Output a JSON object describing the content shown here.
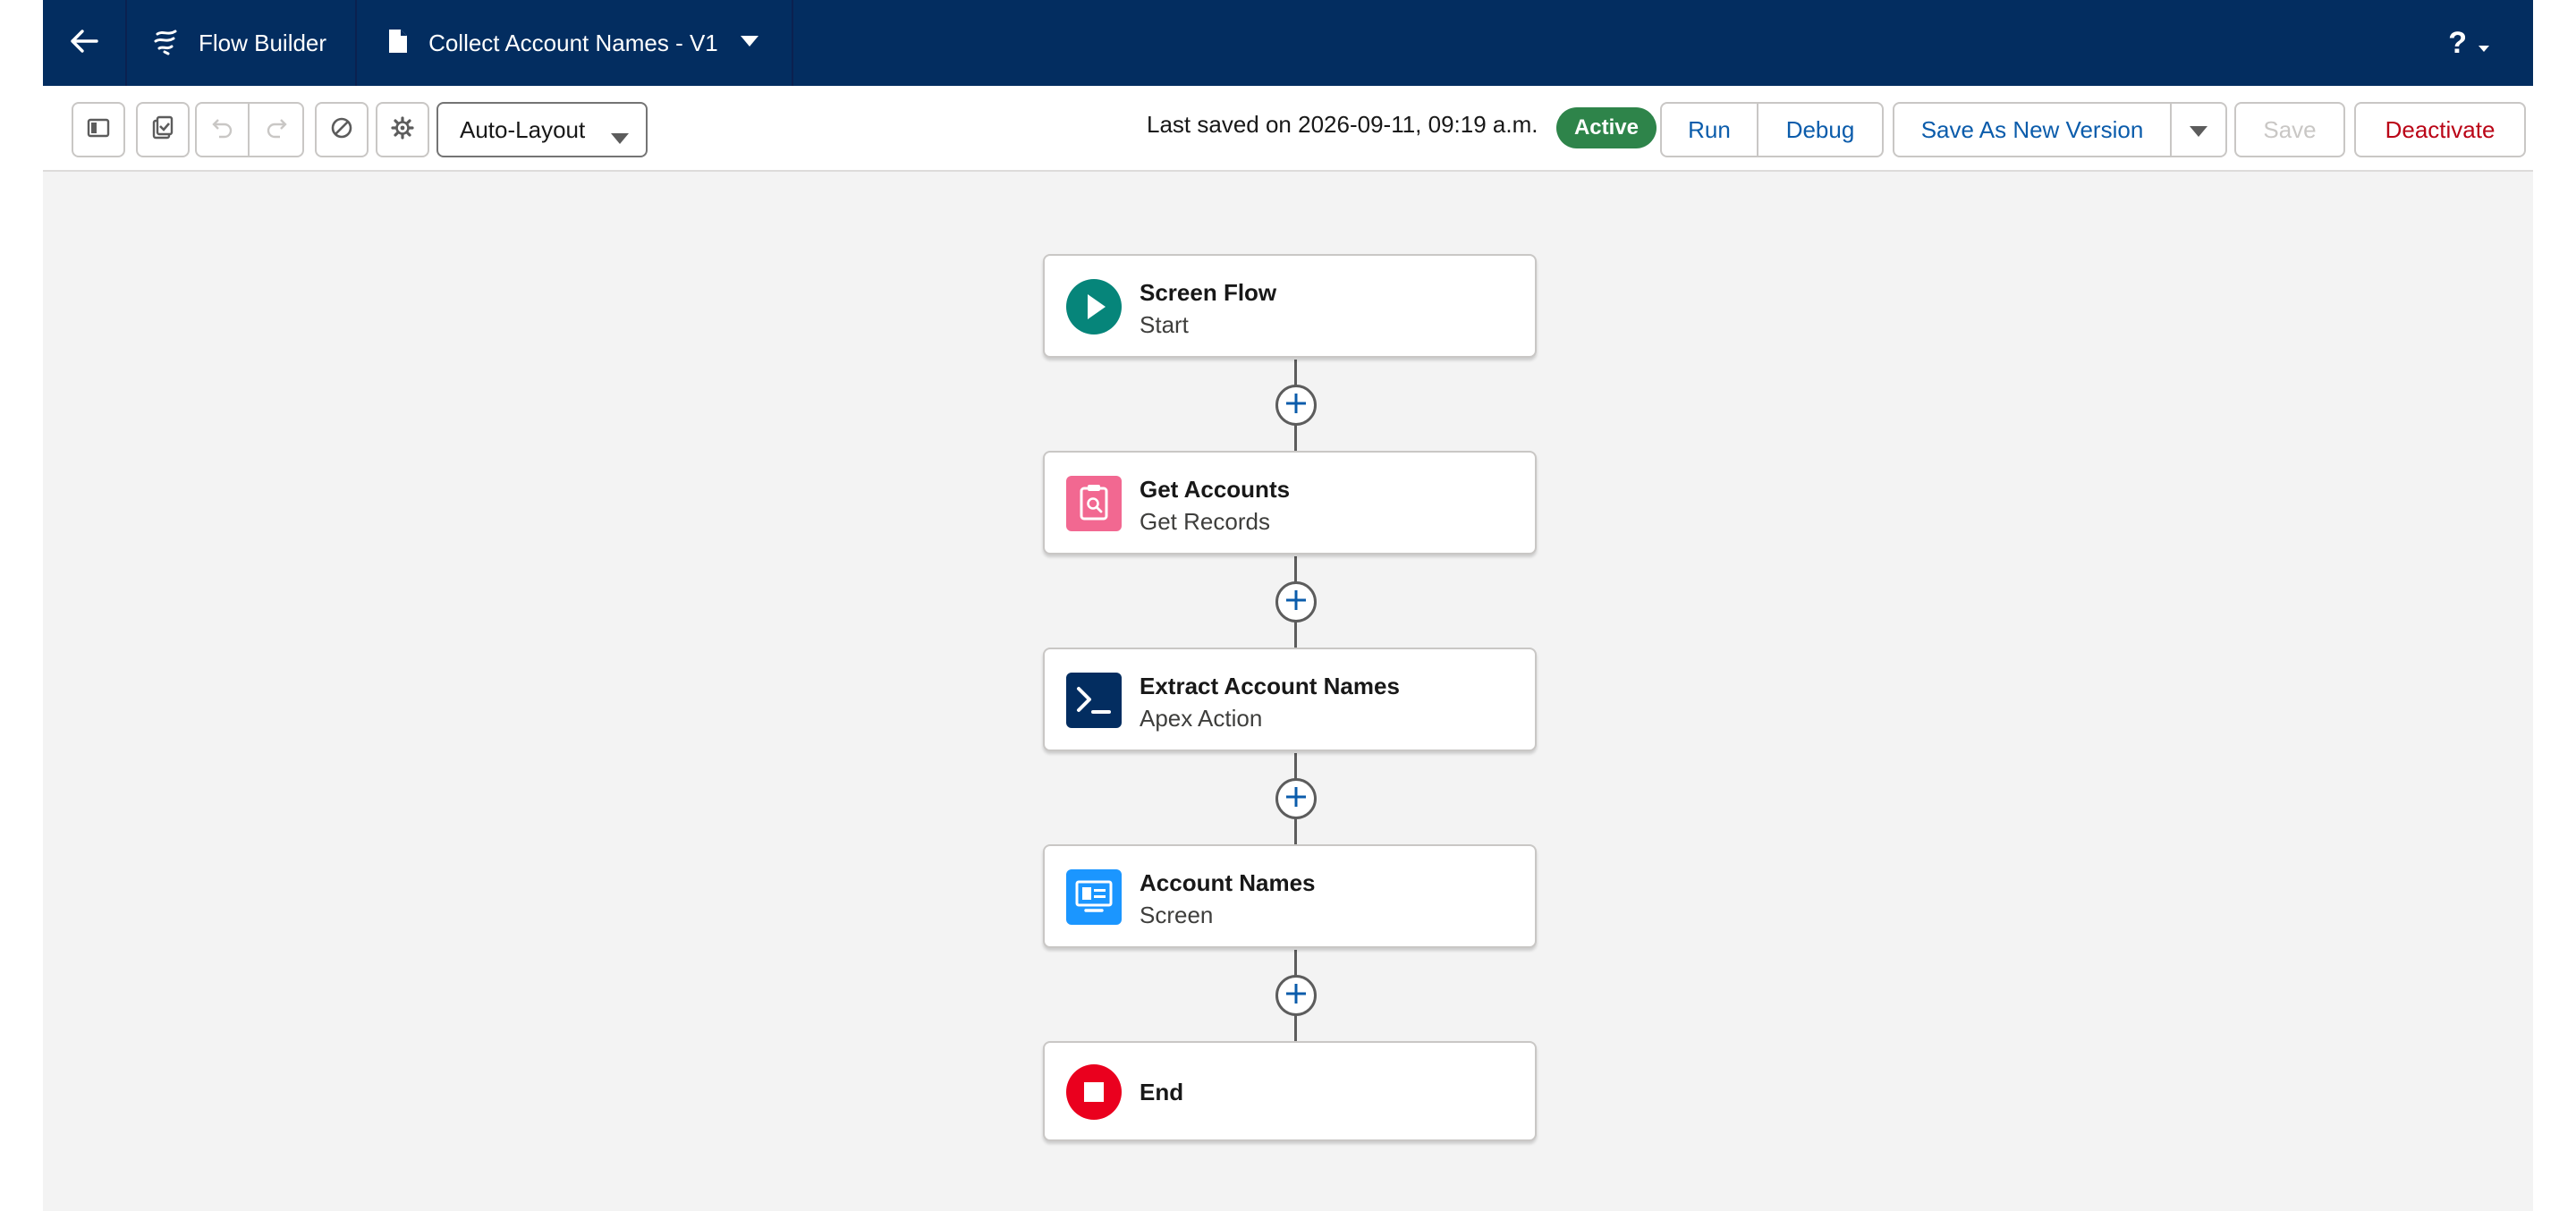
{
  "topbar": {
    "back_icon": "arrow-left-icon",
    "app_name": "Flow Builder",
    "file_name": "Collect Account Names - V1",
    "help_label": "?"
  },
  "toolbar": {
    "layout_mode": "Auto-Layout",
    "last_saved": "Last saved on 2026-09-11, 09:19 a.m.",
    "status_badge": "Active",
    "run_label": "Run",
    "debug_label": "Debug",
    "save_new_version_label": "Save As New Version",
    "save_label": "Save",
    "deactivate_label": "Deactivate"
  },
  "flow": {
    "nodes": [
      {
        "title": "Screen Flow",
        "subtitle": "Start",
        "icon": "play-icon",
        "color": "#06857a"
      },
      {
        "title": "Get Accounts",
        "subtitle": "Get Records",
        "icon": "record-lookup-icon",
        "color": "#f26891"
      },
      {
        "title": "Extract Account Names",
        "subtitle": "Apex Action",
        "icon": "apex-terminal-icon",
        "color": "#032d60"
      },
      {
        "title": "Account Names",
        "subtitle": "Screen",
        "icon": "screen-icon",
        "color": "#1b96ff"
      },
      {
        "title": "End",
        "subtitle": "",
        "icon": "stop-icon",
        "color": "#ea001e"
      }
    ]
  },
  "colors": {
    "nav_bg": "#032d60",
    "canvas_bg": "#f3f3f3",
    "link_blue": "#0b5cab",
    "destructive_red": "#ba0517",
    "active_green": "#2e844a"
  }
}
